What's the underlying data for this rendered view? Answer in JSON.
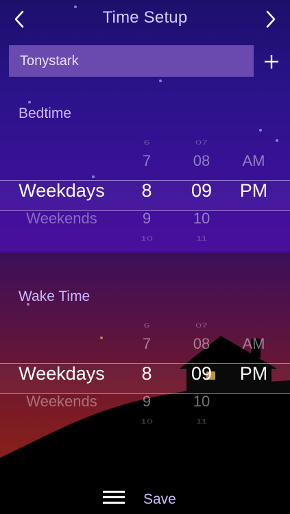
{
  "header": {
    "title": "Time Setup",
    "back_icon": "chevron-left-icon",
    "next_icon": "chevron-right-icon"
  },
  "user": {
    "name": "Tonystark",
    "add_icon": "plus-icon"
  },
  "bedtime": {
    "label": "Bedtime",
    "day_options": [
      "Weekdays",
      "Weekends"
    ],
    "selected_day": "Weekdays",
    "hours": [
      "6",
      "7",
      "8",
      "9",
      "10"
    ],
    "minutes": [
      "07",
      "08",
      "09",
      "10",
      "11"
    ],
    "ampm": [
      "AM",
      "PM"
    ],
    "selected_hour": "8",
    "selected_minute": "09",
    "selected_ampm": "PM"
  },
  "waketime": {
    "label": "Wake Time",
    "day_options": [
      "Weekdays",
      "Weekends"
    ],
    "selected_day": "Weekdays",
    "hours": [
      "6",
      "7",
      "8",
      "9",
      "10"
    ],
    "minutes": [
      "07",
      "08",
      "09",
      "10",
      "11"
    ],
    "ampm": [
      "AM",
      "PM"
    ],
    "selected_hour": "8",
    "selected_minute": "09",
    "selected_ampm": "PM"
  },
  "footer": {
    "menu_icon": "hamburger-menu-icon",
    "save_label": "Save"
  },
  "colors": {
    "night_sky": "#2a138a",
    "dusk_sky": "#7a1a26",
    "accent_text": "#cbb8ff",
    "field_bg": "#6a4aae"
  }
}
